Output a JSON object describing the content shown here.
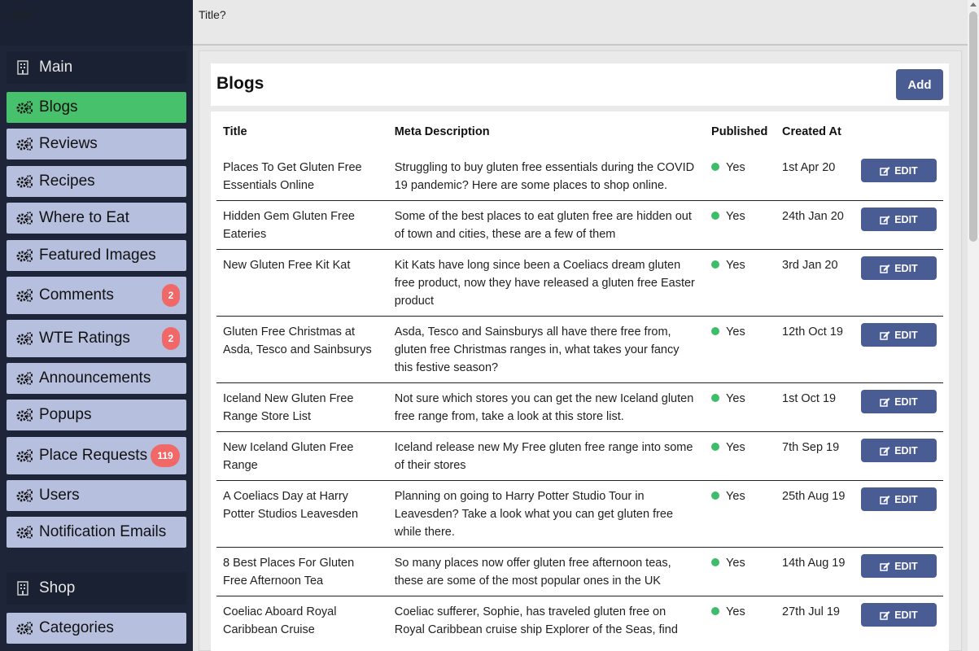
{
  "logo": "Logo",
  "topbar": {
    "title": "Title?"
  },
  "sidebar": {
    "sections": [
      {
        "label": "Main"
      },
      {
        "label": "Shop"
      }
    ],
    "items": [
      {
        "label": "Blogs"
      },
      {
        "label": "Reviews"
      },
      {
        "label": "Recipes"
      },
      {
        "label": "Where to Eat"
      },
      {
        "label": "Featured Images"
      },
      {
        "label": "Comments",
        "badge": "2"
      },
      {
        "label": "WTE Ratings",
        "badge": "2"
      },
      {
        "label": "Announcements"
      },
      {
        "label": "Popups"
      },
      {
        "label": "Place Requests",
        "badge": "119"
      },
      {
        "label": "Users"
      },
      {
        "label": "Notification Emails"
      },
      {
        "label": "Categories"
      }
    ]
  },
  "page": {
    "heading": "Blogs",
    "add_label": "Add"
  },
  "table": {
    "headers": [
      "Title",
      "Meta Description",
      "Published",
      "Created At",
      ""
    ],
    "edit_label": "EDIT",
    "rows": [
      {
        "title": "Places To Get Gluten Free Essentials Online",
        "meta": "Struggling to buy gluten free essentials during the COVID 19 pandemic? Here are some places to shop online.",
        "published": "Yes",
        "created": "1st Apr 20"
      },
      {
        "title": "Hidden Gem Gluten Free Eateries",
        "meta": "Some of the best places to eat gluten free are hidden out of town and cities, these are a few of them",
        "published": "Yes",
        "created": "24th Jan 20"
      },
      {
        "title": "New Gluten Free Kit Kat",
        "meta": "Kit Kats have long since been a Coeliacs dream gluten free product, now they have released a gluten free Easter product",
        "published": "Yes",
        "created": "3rd Jan 20"
      },
      {
        "title": "Gluten Free Christmas at Asda, Tesco and Sainbsurys",
        "meta": "Asda, Tesco and Sainsburys all have there free from, gluten free Christmas ranges in, what takes your fancy this festive season?",
        "published": "Yes",
        "created": "12th Oct 19"
      },
      {
        "title": "Iceland New Gluten Free Range Store List",
        "meta": "Not sure which stores you can get the new Iceland gluten free range from, take a look at this store list.",
        "published": "Yes",
        "created": "1st Oct 19"
      },
      {
        "title": "New Iceland Gluten Free Range",
        "meta": "Iceland release new My Free gluten free range into some of their stores",
        "published": "Yes",
        "created": "7th Sep 19"
      },
      {
        "title": "A Coeliacs Day at Harry Potter Studios Leavesden",
        "meta": "Planning on going to Harry Potter Studio Tour in Leavesden? Take a look what you can get gluten free while there.",
        "published": "Yes",
        "created": "25th Aug 19"
      },
      {
        "title": "8 Best Places For Gluten Free Afternoon Tea",
        "meta": "So many places now offer gluten free afternoon teas, these are some of the most popular ones in the UK",
        "published": "Yes",
        "created": "14th Aug 19"
      },
      {
        "title": "Coeliac Aboard Royal Caribbean Cruise",
        "meta": "Coeliac sufferer, Sophie, has traveled gluten free on Royal Caribbean cruise ship Explorer of the Seas, find",
        "published": "Yes",
        "created": "27th Jul 19"
      }
    ]
  }
}
